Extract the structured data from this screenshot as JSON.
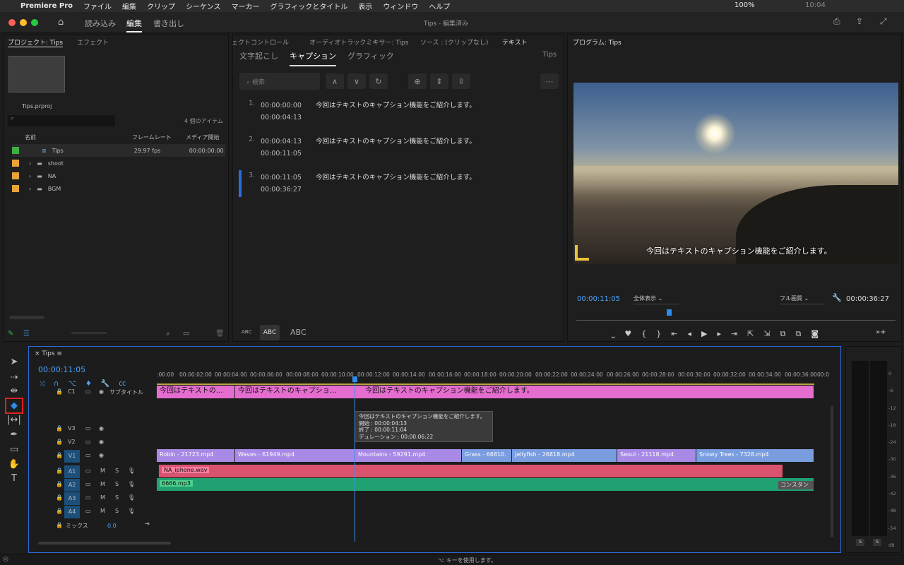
{
  "menubar": {
    "app": "Premiere Pro",
    "items": [
      "ファイル",
      "編集",
      "クリップ",
      "シーケンス",
      "マーカー",
      "グラフィックとタイトル",
      "表示",
      "ウィンドウ",
      "ヘルプ"
    ],
    "battery": "100%",
    "time": "10:04"
  },
  "workspace": {
    "tabs": [
      "読み込み",
      "編集",
      "書き出し"
    ],
    "title": "Tips - 編集済み"
  },
  "project": {
    "tabs": [
      "プロジェクト: Tips",
      "エフェクト"
    ],
    "file": "Tips.prproj",
    "count": "4 個のアイテム",
    "cols": [
      "名前",
      "フレームレート",
      "メディア開始"
    ],
    "items": [
      {
        "name": "Tips",
        "fps": "29.97 fps",
        "start": "00:00:00:00",
        "color": "#3cb043"
      },
      {
        "name": "shoot",
        "color": "#e8a33a"
      },
      {
        "name": "NA",
        "color": "#e8a33a"
      },
      {
        "name": "BGM",
        "color": "#e8a33a"
      }
    ]
  },
  "mid": {
    "tabs": [
      "ェクトコントロール",
      "オーディオトラックミキサー: Tips",
      "ソース : (クリップなし)",
      "テキスト"
    ],
    "subtabs": [
      "文字起こし",
      "キャプション",
      "グラフィック"
    ],
    "seq": "Tips",
    "search": "検索",
    "captions": [
      {
        "n": "1.",
        "in": "00:00:00:00",
        "out": "00:00:04:13",
        "text": "今回はテキストのキャプション機能をご紹介します。"
      },
      {
        "n": "2.",
        "in": "00:00:04:13",
        "out": "00:00:11:05",
        "text": "今回はテキストのキャプション機能をご紹介します。"
      },
      {
        "n": "3.",
        "in": "00:00:11:05",
        "out": "00:00:36:27",
        "text": "今回はテキストのキャプション機能をご紹介します。"
      }
    ],
    "abc": [
      "ABC",
      "ABC",
      "ABC"
    ]
  },
  "program": {
    "title": "プログラム: Tips",
    "subtitle": "今回はテキストのキャプション機能をご紹介します。",
    "tc": "00:00:11:05",
    "fit": "全体表示",
    "quality": "フル画質",
    "dur": "00:00:36:27"
  },
  "timeline": {
    "name": "Tips",
    "tc": "00:00:11:05",
    "ruler": [
      ":00:00",
      "00:00:02:00",
      "00:00:04:00",
      "00:00:06:00",
      "00:00:08:00",
      "00:00:10:00",
      "00:00:12:00",
      "00:00:14:00",
      "00:00:16:00",
      "00:00:18:00",
      "00:00:20:00",
      "00:00:22:00",
      "00:00:24:00",
      "00:00:26:00",
      "00:00:28:00",
      "00:00:30:00",
      "00:00:32:00",
      "00:00:34:00",
      "00:00:36:00",
      "00:0"
    ],
    "subtitle_track": "サブタイトル",
    "c1": "C1",
    "subclips": [
      "今回はテキストの…",
      "今回はテキストのキャプショ…",
      "今回はテキストのキャプション機能をご紹介します。"
    ],
    "tooltip": [
      "今回はテキストのキャプション機能をご紹介します。",
      "開始 : 00:00:04:13",
      "終了 : 00:00:11:04",
      "デュレーション : 00:00:06:22"
    ],
    "vtracks": [
      "V3",
      "V2",
      "V1"
    ],
    "atracks": [
      "A1",
      "A2",
      "A3",
      "A4"
    ],
    "mix": "ミックス",
    "mixval": "0.0",
    "vclips": [
      "Robin - 21723.mp4",
      "Waves - 61949.mp4",
      "Mountains - 59291.mp4",
      "Grass - 66810.",
      "Jellyfish - 26818.mp4",
      "Seoul - 21118.mp4",
      "Snowy Trees - 7328.mp4"
    ],
    "aclips": [
      "NA_iphone.wav",
      "6666.mp3",
      "コンスタン"
    ]
  },
  "meter": [
    "0",
    "-6",
    "-12",
    "-18",
    "-24",
    "-30",
    "-36",
    "-42",
    "-48",
    "-54",
    "dB"
  ],
  "status": "⌥ キーを使用します。"
}
